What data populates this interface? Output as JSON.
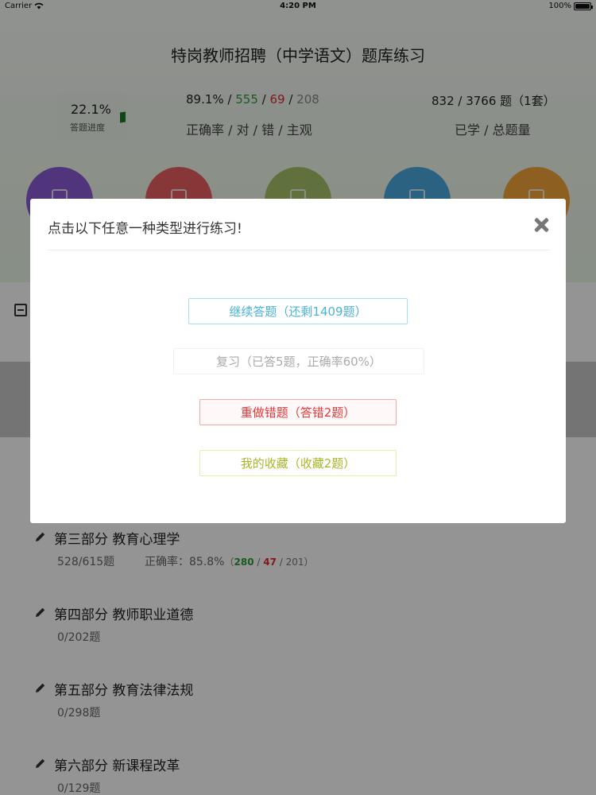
{
  "status_bar": {
    "carrier": "Carrier",
    "time": "4:20 PM",
    "battery": "100%"
  },
  "header": {
    "title": "特岗教师招聘（中学语文）题库练习",
    "progress": {
      "percent": "22.1%",
      "label": "答题进度"
    },
    "accuracy": {
      "rate": "89.1%",
      "correct": "555",
      "wrong": "69",
      "subjective": "208",
      "sep": " / ",
      "label": "正确率 / 对 / 错 / 主观"
    },
    "studied": {
      "value": "832 / 3766 题（1套）",
      "label": "已学 / 总题量"
    }
  },
  "colors": {
    "circle_purple": "#8a5ad6",
    "circle_red": "#e86060",
    "circle_green": "#a8c36a",
    "circle_blue": "#4aa9e0",
    "circle_orange": "#f3a63a",
    "correct": "#2e9b39",
    "wrong": "#e12b2b"
  },
  "modal": {
    "title": "点击以下任意一种类型进行练习!",
    "options": {
      "continue": "继续答题（还剩1409题）",
      "review": "复习（已答5题，正确率60%）",
      "redo": "重做错题（答错2题）",
      "favorite": "我的收藏（收藏2题）"
    }
  },
  "sections": [
    {
      "title": "第三部分 教育心理学",
      "count": "528/615题",
      "acc_label": "正确率：85.8%",
      "acc_open": "（",
      "acc_correct": "280",
      "acc_sep1": " / ",
      "acc_wrong": "47",
      "acc_sep2": " / ",
      "acc_subj": "201",
      "acc_close": "）"
    },
    {
      "title": "第四部分 教师职业道德",
      "count": "0/202题"
    },
    {
      "title": "第五部分 教育法律法规",
      "count": "0/298题"
    },
    {
      "title": "第六部分 新课程改革",
      "count": "0/129题"
    }
  ]
}
